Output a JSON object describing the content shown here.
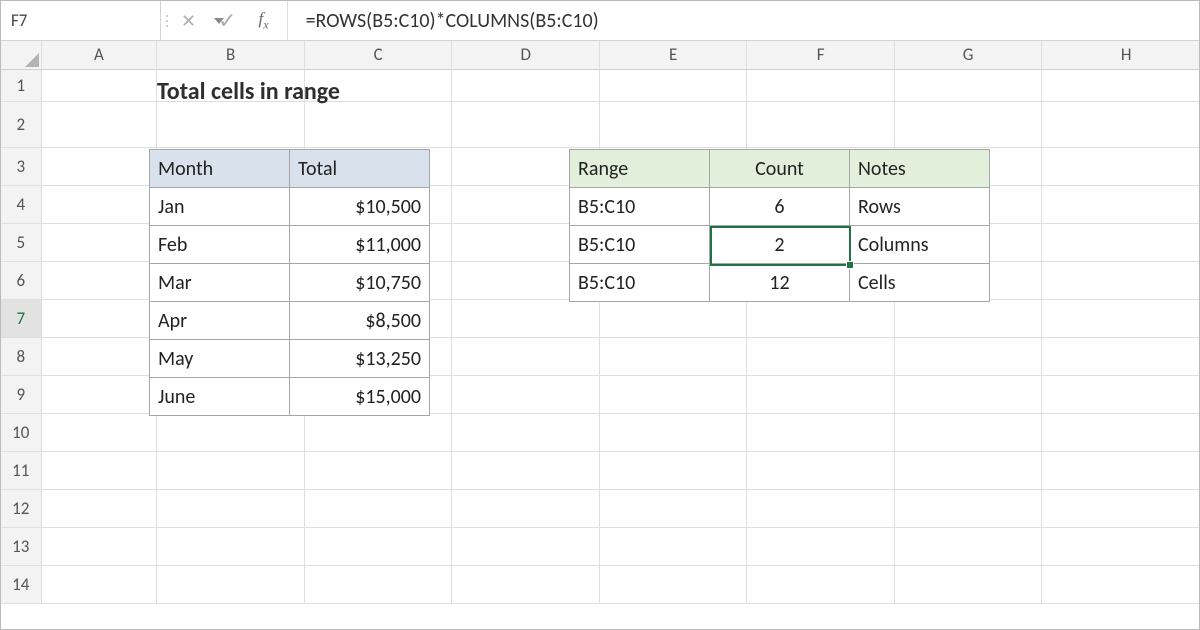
{
  "name_box": "F7",
  "formula": "=ROWS(B5:C10)*COLUMNS(B5:C10)",
  "col_headers": [
    "A",
    "B",
    "C",
    "D",
    "E",
    "F",
    "G",
    "H"
  ],
  "row_headers": [
    "1",
    "2",
    "3",
    "4",
    "5",
    "6",
    "7",
    "8",
    "9",
    "10",
    "11",
    "12",
    "13",
    "14"
  ],
  "active_col": "F",
  "active_row": "7",
  "title": "Total cells in range",
  "table_left": {
    "headers": [
      "Month",
      "Total"
    ],
    "rows": [
      {
        "month": "Jan",
        "total": "$10,500"
      },
      {
        "month": "Feb",
        "total": "$11,000"
      },
      {
        "month": "Mar",
        "total": "$10,750"
      },
      {
        "month": "Apr",
        "total": "$8,500"
      },
      {
        "month": "May",
        "total": "$13,250"
      },
      {
        "month": "June",
        "total": "$15,000"
      }
    ]
  },
  "table_right": {
    "headers": [
      "Range",
      "Count",
      "Notes"
    ],
    "rows": [
      {
        "range": "B5:C10",
        "count": "6",
        "notes": "Rows"
      },
      {
        "range": "B5:C10",
        "count": "2",
        "notes": "Columns"
      },
      {
        "range": "B5:C10",
        "count": "12",
        "notes": "Cells"
      }
    ]
  }
}
